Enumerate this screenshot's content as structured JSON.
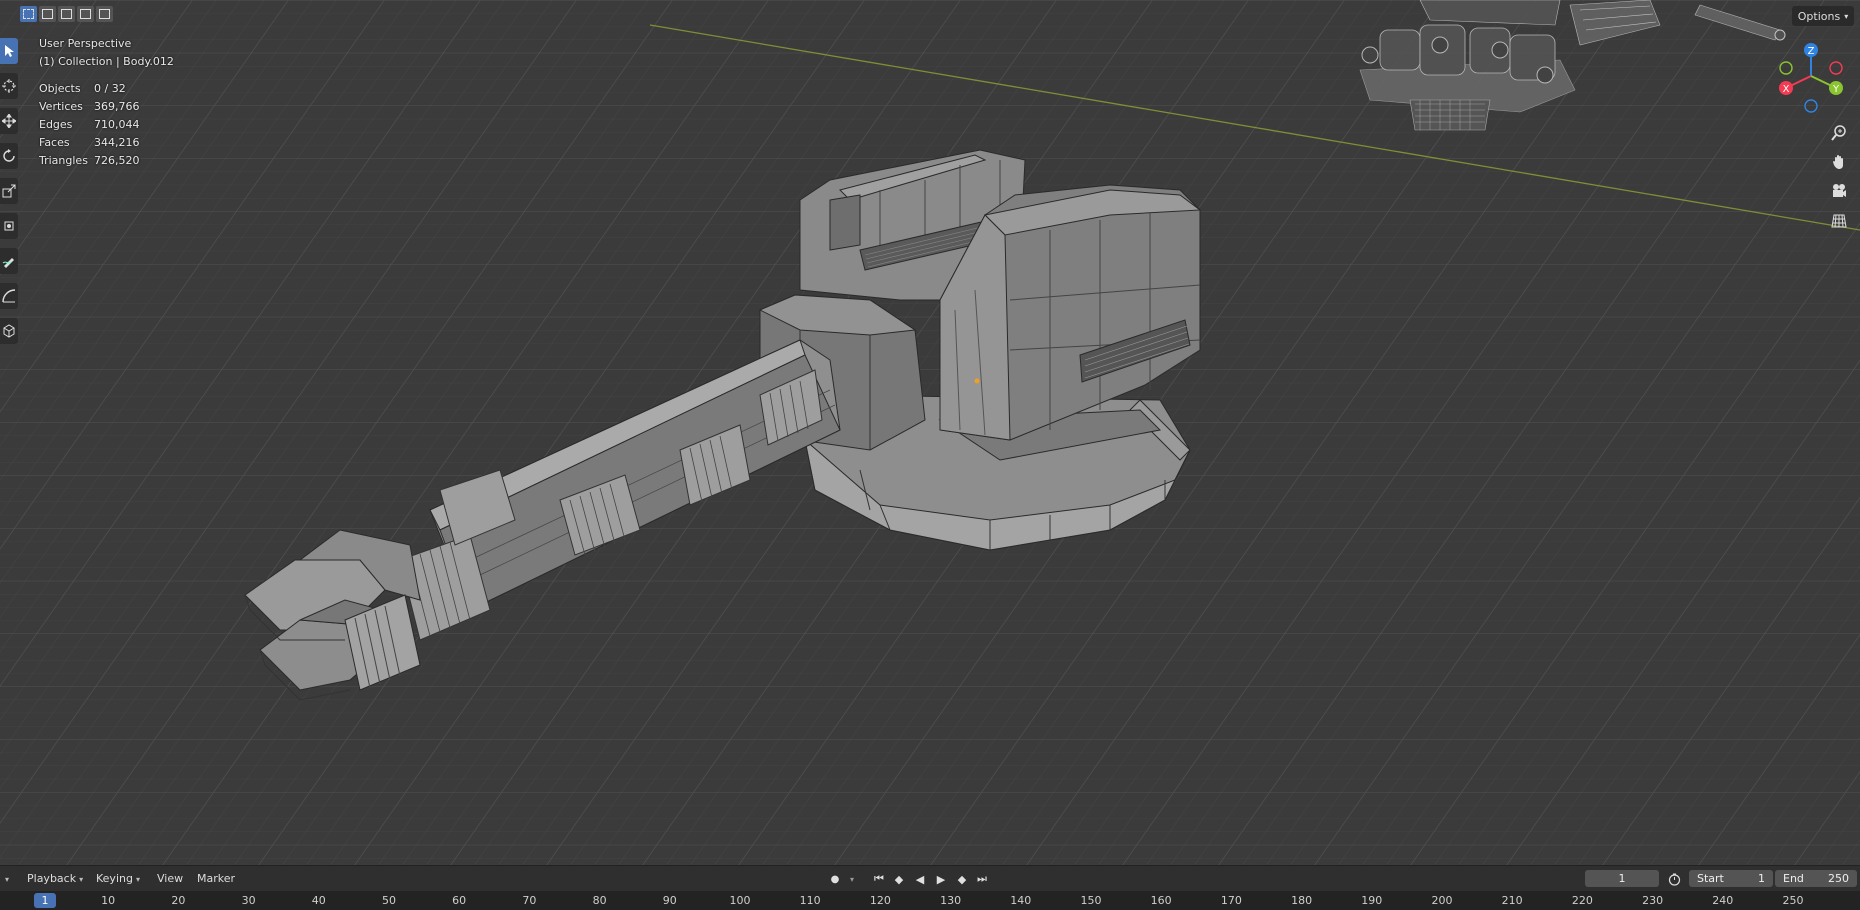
{
  "viewport": {
    "perspective_label": "User Perspective",
    "collection_label": "(1) Collection | Body.012",
    "stats": [
      {
        "label": "Objects",
        "value": "0 / 32"
      },
      {
        "label": "Vertices",
        "value": "369,766"
      },
      {
        "label": "Edges",
        "value": "710,044"
      },
      {
        "label": "Faces",
        "value": "344,216"
      },
      {
        "label": "Triangles",
        "value": "726,520"
      }
    ],
    "options_label": "Options",
    "gizmo_axes": {
      "z": "Z",
      "x": "X",
      "y": "Y"
    },
    "colors": {
      "x_axis": "#f53a53",
      "y_axis": "#8ac42f",
      "z_axis": "#2f84e3",
      "accent": "#4772b3"
    },
    "left_tools": [
      "select-box-icon",
      "cursor-icon",
      "move-icon",
      "rotate-icon",
      "scale-icon",
      "transform-icon",
      "annotate-icon",
      "measure-icon",
      "add-cube-icon"
    ],
    "right_nav": [
      "zoom-icon",
      "pan-hand-icon",
      "camera-icon",
      "grid-icon"
    ]
  },
  "timeline": {
    "menus": {
      "playback": "Playback",
      "keying": "Keying",
      "view": "View",
      "marker": "Marker"
    },
    "current_frame": "1",
    "start_label": "Start",
    "start_value": "1",
    "end_label": "End",
    "end_value": "250",
    "ruler_current": "1",
    "ruler_ticks": [
      "10",
      "20",
      "30",
      "40",
      "50",
      "60",
      "70",
      "80",
      "90",
      "100",
      "110",
      "120",
      "130",
      "140",
      "150",
      "160",
      "170",
      "180",
      "190",
      "200",
      "210",
      "220",
      "230",
      "240",
      "250"
    ]
  }
}
